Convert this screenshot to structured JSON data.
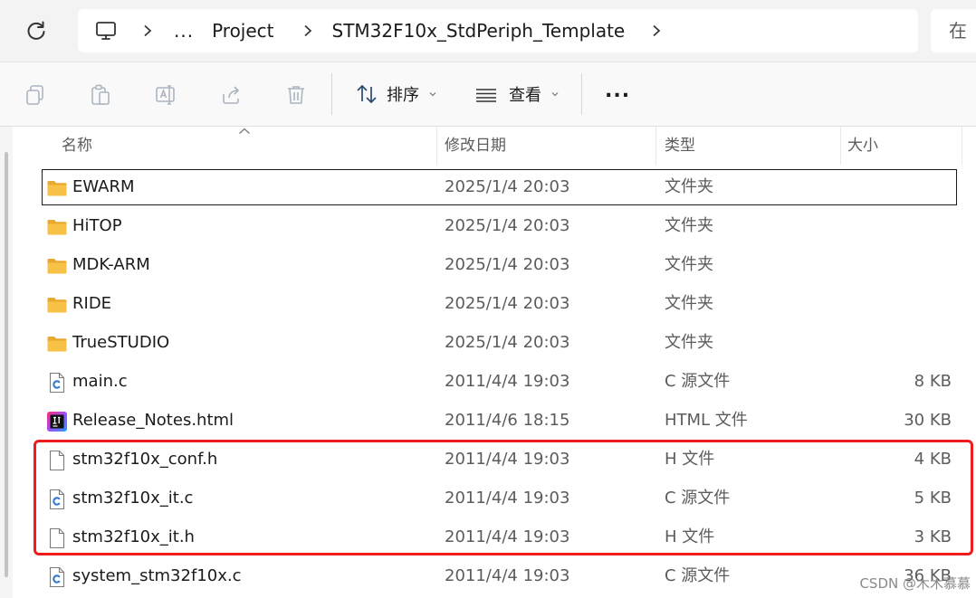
{
  "address": {
    "crumbs": [
      "...",
      "Project",
      "STM32F10x_StdPeriph_Template"
    ],
    "search_placeholder": "在"
  },
  "toolbar": {
    "sort_label": "排序",
    "view_label": "查看",
    "more_label": "..."
  },
  "columns": {
    "name": "名称",
    "date": "修改日期",
    "type": "类型",
    "size": "大小"
  },
  "rows": [
    {
      "name": "EWARM",
      "date": "2025/1/4 20:03",
      "type": "文件夹",
      "size": "",
      "icon": "folder-icon"
    },
    {
      "name": "HiTOP",
      "date": "2025/1/4 20:03",
      "type": "文件夹",
      "size": "",
      "icon": "folder-icon"
    },
    {
      "name": "MDK-ARM",
      "date": "2025/1/4 20:03",
      "type": "文件夹",
      "size": "",
      "icon": "folder-icon"
    },
    {
      "name": "RIDE",
      "date": "2025/1/4 20:03",
      "type": "文件夹",
      "size": "",
      "icon": "folder-icon"
    },
    {
      "name": "TrueSTUDIO",
      "date": "2025/1/4 20:03",
      "type": "文件夹",
      "size": "",
      "icon": "folder-icon"
    },
    {
      "name": "main.c",
      "date": "2011/4/4 19:03",
      "type": "C 源文件",
      "size": "8 KB",
      "icon": "c-file-icon"
    },
    {
      "name": "Release_Notes.html",
      "date": "2011/4/6 18:15",
      "type": "HTML 文件",
      "size": "30 KB",
      "icon": "html-file-icon"
    },
    {
      "name": "stm32f10x_conf.h",
      "date": "2011/4/4 19:03",
      "type": "H 文件",
      "size": "4 KB",
      "icon": "h-file-icon"
    },
    {
      "name": "stm32f10x_it.c",
      "date": "2011/4/4 19:03",
      "type": "C 源文件",
      "size": "5 KB",
      "icon": "c-file-icon"
    },
    {
      "name": "stm32f10x_it.h",
      "date": "2011/4/4 19:03",
      "type": "H 文件",
      "size": "3 KB",
      "icon": "h-file-icon"
    },
    {
      "name": "system_stm32f10x.c",
      "date": "2011/4/4 19:03",
      "type": "C 源文件",
      "size": "36 KB",
      "icon": "c-file-icon"
    }
  ],
  "watermark": "CSDN @木木慕慕",
  "colors": {
    "highlight": "#ee1c1c",
    "folder": "#f7c245",
    "accent": "#2f7bd1"
  }
}
